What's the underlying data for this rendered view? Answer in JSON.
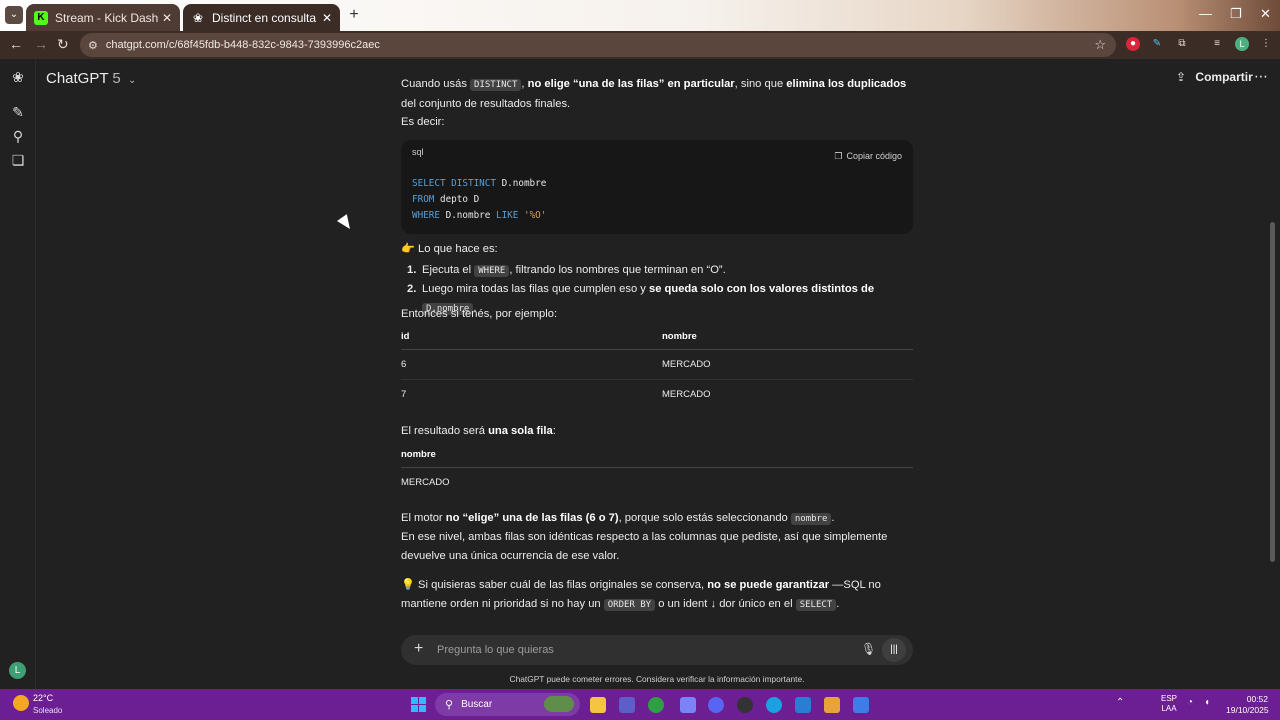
{
  "browser": {
    "tabs": [
      {
        "title": "Stream - Kick Dashboard",
        "favicon": "K"
      },
      {
        "title": "Distinct en consulta SQL",
        "favicon": "chatgpt-logo"
      }
    ],
    "url": "chatgpt.com/c/68f45fdb-b448-832c-9843-7393996c2aec",
    "profile_initial": "L"
  },
  "app": {
    "model_name": "ChatGPT",
    "model_version": "5",
    "share_label": "Compartir",
    "user_initial": "L"
  },
  "conversation": {
    "p1": {
      "t1": "Cuando usás ",
      "code": "DISTINCT",
      "t2": ", ",
      "b1": "no elige “una de las filas” en particular",
      "t3": ", sino que ",
      "b2": "elimina los duplicados",
      "t4": " del conjunto de resultados finales."
    },
    "es_decir": "Es decir:",
    "code_block": {
      "lang": "sql",
      "copy_label": "Copiar código",
      "lines": [
        {
          "kw": "SELECT DISTINCT",
          "rest": " D.nombre",
          "str": ""
        },
        {
          "kw": "FROM",
          "rest": " depto D",
          "str": ""
        },
        {
          "kw": "WHERE",
          "rest": " D.nombre ",
          "kw2": "LIKE",
          "str": " '%O'"
        }
      ]
    },
    "lo_que_hace": "👉 Lo que hace es:",
    "steps": [
      {
        "num": "1.",
        "t1": "Ejecuta el ",
        "code": "WHERE",
        "t2": ", filtrando los nombres que terminan en “O”."
      },
      {
        "num": "2.",
        "t1": "Luego mira todas las filas que cumplen eso y ",
        "b": "se queda solo con los valores distintos de",
        "code": "D.nombre",
        "t2": "."
      }
    ],
    "entonces": "Entonces si tenés, por ejemplo:",
    "table1": {
      "headers": [
        "id",
        "nombre"
      ],
      "rows": [
        [
          "6",
          "MERCADO"
        ],
        [
          "7",
          "MERCADO"
        ]
      ]
    },
    "resultado": {
      "t1": "El resultado será ",
      "b": "una sola fila",
      "t2": ":"
    },
    "table2": {
      "headers": [
        "nombre"
      ],
      "rows": [
        [
          "MERCADO"
        ]
      ]
    },
    "motor": {
      "t1": "El motor ",
      "b": "no “elige” una de las filas (6 o 7)",
      "t2": ", porque solo estás seleccionando ",
      "code": "nombre",
      "t3": "."
    },
    "nivel": "En ese nivel, ambas filas son idénticas respecto a las columnas que pediste, así que simplemente devuelve una única ocurrencia de ese valor.",
    "quisieras": {
      "t1": "💡 Si quisieras saber cuál de las filas originales se conserva, ",
      "b": "no se puede garantizar",
      "t2": " —SQL no mantiene orden ni prioridad si no hay un ",
      "code1": "ORDER BY",
      "t3": " o un ident",
      "arrow": "↓",
      "t4": "dor único en el ",
      "code2": "SELECT",
      "t5": "."
    }
  },
  "composer": {
    "placeholder": "Pregunta lo que quieras"
  },
  "disclaimer": "ChatGPT puede cometer errores. Considera verificar la información importante.",
  "taskbar": {
    "temperature": "22°C",
    "weather": "Soleado",
    "search_label": "Buscar",
    "lang_line1": "ESP",
    "lang_line2": "LAA",
    "time": "00:52",
    "date": "19/10/2025"
  },
  "colors": {
    "background": "#212121",
    "browser_frame": "#3c2c26",
    "taskbar": "#6b1f93",
    "sql_keyword": "#5a9fd6",
    "sql_string": "#d4a356"
  }
}
